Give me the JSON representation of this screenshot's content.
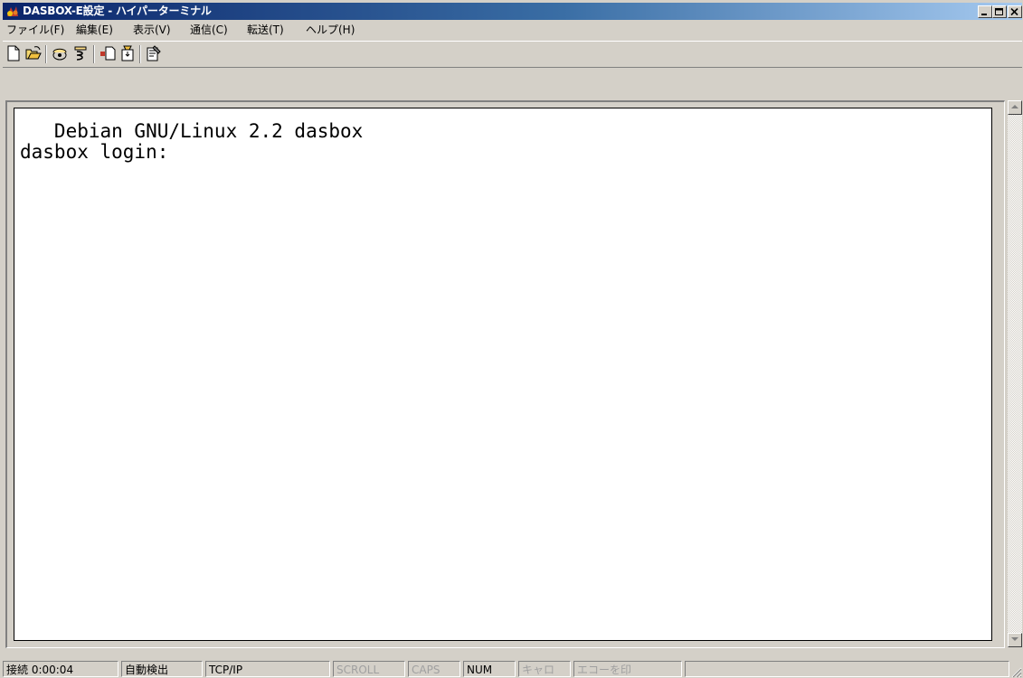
{
  "window": {
    "title": "DASBOX-E設定 - ハイパーターミナル",
    "controls": {
      "minimize": "_",
      "maximize": "□",
      "close": "X"
    }
  },
  "menu": {
    "items": [
      {
        "label": "ファイル(F)"
      },
      {
        "label": "編集(E)"
      },
      {
        "label": "表示(V)"
      },
      {
        "label": "通信(C)"
      },
      {
        "label": "転送(T)"
      },
      {
        "label": "ヘルプ(H)"
      }
    ]
  },
  "toolbar": {
    "icons": [
      "new-icon",
      "open-icon",
      "connect-icon",
      "disconnect-icon",
      "send-icon",
      "receive-icon",
      "properties-icon"
    ]
  },
  "terminal": {
    "lines": [
      "   Debian GNU/Linux 2.2 dasbox",
      "dasbox login:"
    ]
  },
  "status": {
    "connection": "接続 0:00:04",
    "detect": "自動検出",
    "protocol": "TCP/IP",
    "scroll": "SCROLL",
    "caps": "CAPS",
    "num": "NUM",
    "capture": "キャロ",
    "echo": "エコーを印"
  },
  "colors": {
    "titlebar_start": "#0a246a",
    "titlebar_end": "#a6caf0",
    "face": "#d4d0c8",
    "terminal_bg": "#ffffff"
  }
}
